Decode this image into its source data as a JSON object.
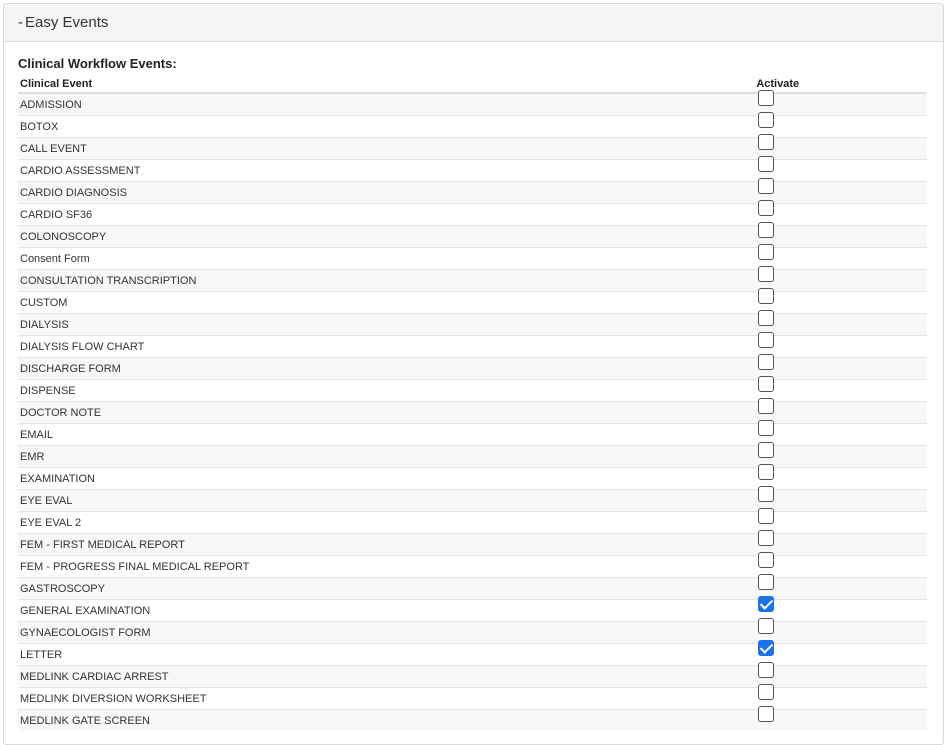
{
  "panel": {
    "toggle": "-",
    "title": "Easy Events"
  },
  "section_title": "Clinical Workflow Events:",
  "table": {
    "headers": {
      "event": "Clinical Event",
      "activate": "Activate"
    },
    "rows": [
      {
        "label": "ADMISSION",
        "checked": false
      },
      {
        "label": "BOTOX",
        "checked": false
      },
      {
        "label": "CALL EVENT",
        "checked": false
      },
      {
        "label": "CARDIO ASSESSMENT",
        "checked": false
      },
      {
        "label": "CARDIO DIAGNOSIS",
        "checked": false
      },
      {
        "label": "CARDIO SF36",
        "checked": false
      },
      {
        "label": "COLONOSCOPY",
        "checked": false
      },
      {
        "label": "Consent Form",
        "checked": false
      },
      {
        "label": "CONSULTATION TRANSCRIPTION",
        "checked": false
      },
      {
        "label": "CUSTOM",
        "checked": false
      },
      {
        "label": "DIALYSIS",
        "checked": false
      },
      {
        "label": "DIALYSIS FLOW CHART",
        "checked": false
      },
      {
        "label": "DISCHARGE FORM",
        "checked": false
      },
      {
        "label": "DISPENSE",
        "checked": false
      },
      {
        "label": "DOCTOR NOTE",
        "checked": false
      },
      {
        "label": "EMAIL",
        "checked": false
      },
      {
        "label": "EMR",
        "checked": false
      },
      {
        "label": "EXAMINATION",
        "checked": false
      },
      {
        "label": "EYE EVAL",
        "checked": false
      },
      {
        "label": "EYE EVAL 2",
        "checked": false
      },
      {
        "label": "FEM - FIRST MEDICAL REPORT",
        "checked": false
      },
      {
        "label": "FEM - PROGRESS FINAL MEDICAL REPORT",
        "checked": false
      },
      {
        "label": "GASTROSCOPY",
        "checked": false
      },
      {
        "label": "GENERAL EXAMINATION",
        "checked": true
      },
      {
        "label": "GYNAECOLOGIST FORM",
        "checked": false
      },
      {
        "label": "LETTER",
        "checked": true
      },
      {
        "label": "MEDLINK CARDIAC ARREST",
        "checked": false
      },
      {
        "label": "MEDLINK DIVERSION WORKSHEET",
        "checked": false
      },
      {
        "label": "MEDLINK GATE SCREEN",
        "checked": false
      }
    ]
  },
  "colors": {
    "checkbox_checked": "#1a73e8",
    "header_bg": "#f5f5f5"
  }
}
